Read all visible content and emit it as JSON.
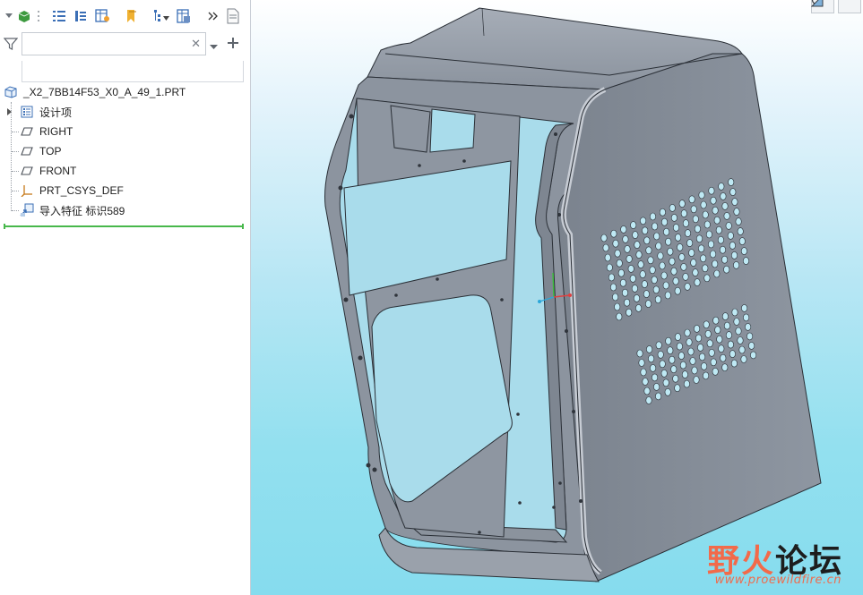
{
  "filter": {
    "placeholder": "",
    "value": ""
  },
  "tree": {
    "root": "_X2_7BB14F53_X0_A_49_1.PRT",
    "items": [
      {
        "label": "设计项",
        "icon": "design-items-icon"
      },
      {
        "label": "RIGHT",
        "icon": "datum-plane-icon"
      },
      {
        "label": "TOP",
        "icon": "datum-plane-icon"
      },
      {
        "label": "FRONT",
        "icon": "datum-plane-icon"
      },
      {
        "label": "PRT_CSYS_DEF",
        "icon": "csys-icon"
      },
      {
        "label": "导入特征 标识589",
        "icon": "import-feature-icon"
      }
    ]
  },
  "watermark": {
    "brand_part1": "野火",
    "brand_part2": "论坛",
    "url": "www.proewildfire.cn"
  },
  "colors": {
    "model_face": "#8a929f",
    "model_edge": "#2a2f36",
    "insert_line": "#47b84b",
    "watermark_red": "#f26a4a"
  }
}
